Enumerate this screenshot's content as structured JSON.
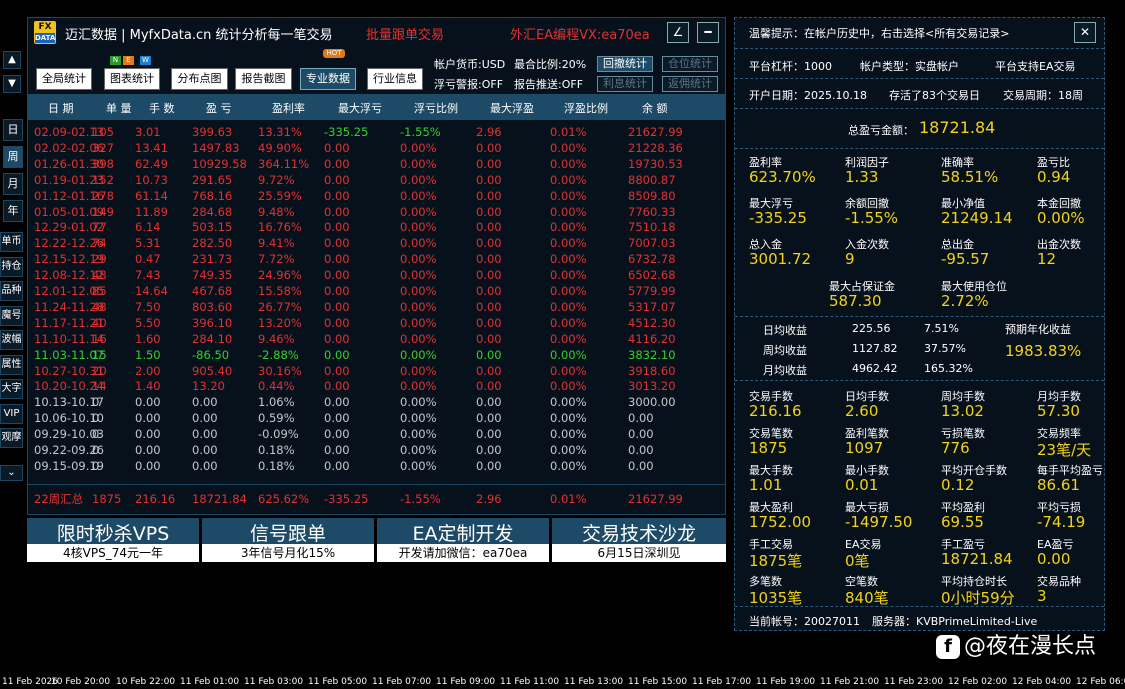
{
  "header": {
    "logo_top": "FX",
    "logo_bottom": "DATA",
    "title": "迈汇数据 | MyfxData.cn  统计分析每一笔交易",
    "batch": "批量跟单交易",
    "vx": "外汇EA编程VX:ea70ea",
    "pen": "∠",
    "minus": "━"
  },
  "nav": [
    {
      "label": "全局统计",
      "sel": false
    },
    {
      "label": "图表统计",
      "sel": false
    },
    {
      "label": "分布点图",
      "sel": false
    },
    {
      "label": "报告截图",
      "sel": false
    },
    {
      "label": "专业数据",
      "sel": true
    },
    {
      "label": "行业信息",
      "sel": false
    }
  ],
  "badges": {
    "n": "N",
    "e": "E",
    "w": "W",
    "hot": "HOT"
  },
  "info": {
    "currency": "帐户货币:USD",
    "ratio": "最合比例:20%",
    "float_alert": "浮亏警报:OFF",
    "report_push": "报告推送:OFF"
  },
  "small_buttons": [
    {
      "label": "回撤统计",
      "on": true
    },
    {
      "label": "仓位统计",
      "on": false
    },
    {
      "label": "利息统计",
      "on": false
    },
    {
      "label": "返佣统计",
      "on": false
    }
  ],
  "columns": [
    "日 期",
    "单 量",
    "手 数",
    "盈 亏",
    "盈利率",
    "最大浮亏",
    "浮亏比例",
    "最大浮盈",
    "浮盈比例",
    "余 额"
  ],
  "rows": [
    {
      "c": [
        "02.09-02.13",
        "105",
        "3.01",
        "399.63",
        "13.31%",
        "-335.25",
        "-1.55%",
        "2.96",
        "0.01%",
        "21627.99"
      ],
      "color": "#e23131",
      "special": true
    },
    {
      "c": [
        "02.02-02.06",
        "327",
        "13.41",
        "1497.83",
        "49.90%",
        "0.00",
        "0.00%",
        "0.00",
        "0.00%",
        "21228.36"
      ],
      "color": "#e23131"
    },
    {
      "c": [
        "01.26-01.30",
        "398",
        "62.49",
        "10929.58",
        "364.11%",
        "0.00",
        "0.00%",
        "0.00",
        "0.00%",
        "19730.53"
      ],
      "color": "#e23131"
    },
    {
      "c": [
        "01.19-01.23",
        "152",
        "10.73",
        "291.65",
        "9.72%",
        "0.00",
        "0.00%",
        "0.00",
        "0.00%",
        "8800.87"
      ],
      "color": "#e23131"
    },
    {
      "c": [
        "01.12-01.16",
        "278",
        "61.14",
        "768.16",
        "25.59%",
        "0.00",
        "0.00%",
        "0.00",
        "0.00%",
        "8509.80"
      ],
      "color": "#e23131"
    },
    {
      "c": [
        "01.05-01.09",
        "149",
        "11.89",
        "284.68",
        "9.48%",
        "0.00",
        "0.00%",
        "0.00",
        "0.00%",
        "7760.33"
      ],
      "color": "#e23131"
    },
    {
      "c": [
        "12.29-01.02",
        "77",
        "6.14",
        "503.15",
        "16.76%",
        "0.00",
        "0.00%",
        "0.00",
        "0.00%",
        "7510.18"
      ],
      "color": "#e23131"
    },
    {
      "c": [
        "12.22-12.26",
        "74",
        "5.31",
        "282.50",
        "9.41%",
        "0.00",
        "0.00%",
        "0.00",
        "0.00%",
        "7007.03"
      ],
      "color": "#e23131"
    },
    {
      "c": [
        "12.15-12.19",
        "29",
        "0.47",
        "231.73",
        "7.72%",
        "0.00",
        "0.00%",
        "0.00",
        "0.00%",
        "6732.78"
      ],
      "color": "#e23131"
    },
    {
      "c": [
        "12.08-12.12",
        "48",
        "7.43",
        "749.35",
        "24.96%",
        "0.00",
        "0.00%",
        "0.00",
        "0.00%",
        "6502.68"
      ],
      "color": "#e23131"
    },
    {
      "c": [
        "12.01-12.05",
        "85",
        "14.64",
        "467.68",
        "15.58%",
        "0.00",
        "0.00%",
        "0.00",
        "0.00%",
        "5779.99"
      ],
      "color": "#e23131"
    },
    {
      "c": [
        "11.24-11.28",
        "48",
        "7.50",
        "803.60",
        "26.77%",
        "0.00",
        "0.00%",
        "0.00",
        "0.00%",
        "5317.07"
      ],
      "color": "#e23131"
    },
    {
      "c": [
        "11.17-11.21",
        "40",
        "5.50",
        "396.10",
        "13.20%",
        "0.00",
        "0.00%",
        "0.00",
        "0.00%",
        "4512.30"
      ],
      "color": "#e23131"
    },
    {
      "c": [
        "11.10-11.14",
        "16",
        "1.60",
        "284.10",
        "9.46%",
        "0.00",
        "0.00%",
        "0.00",
        "0.00%",
        "4116.20"
      ],
      "color": "#e23131"
    },
    {
      "c": [
        "11.03-11.07",
        "15",
        "1.50",
        "-86.50",
        "-2.88%",
        "0.00",
        "0.00%",
        "0.00",
        "0.00%",
        "3832.10"
      ],
      "color": "#33d12e"
    },
    {
      "c": [
        "10.27-10.31",
        "20",
        "2.00",
        "905.40",
        "30.16%",
        "0.00",
        "0.00%",
        "0.00",
        "0.00%",
        "3918.60"
      ],
      "color": "#e23131"
    },
    {
      "c": [
        "10.20-10.24",
        "14",
        "1.40",
        "13.20",
        "0.44%",
        "0.00",
        "0.00%",
        "0.00",
        "0.00%",
        "3013.20"
      ],
      "color": "#e23131"
    },
    {
      "c": [
        "10.13-10.17",
        "0",
        "0.00",
        "0.00",
        "1.06%",
        "0.00",
        "0.00%",
        "0.00",
        "0.00%",
        "3000.00"
      ],
      "color": "#c8c8c8"
    },
    {
      "c": [
        "10.06-10.10",
        "0",
        "0.00",
        "0.00",
        "0.59%",
        "0.00",
        "0.00%",
        "0.00",
        "0.00%",
        "0.00"
      ],
      "color": "#c8c8c8"
    },
    {
      "c": [
        "09.29-10.03",
        "0",
        "0.00",
        "0.00",
        "-0.09%",
        "0.00",
        "0.00%",
        "0.00",
        "0.00%",
        "0.00"
      ],
      "color": "#c8c8c8"
    },
    {
      "c": [
        "09.22-09.26",
        "0",
        "0.00",
        "0.00",
        "0.18%",
        "0.00",
        "0.00%",
        "0.00",
        "0.00%",
        "0.00"
      ],
      "color": "#c8c8c8"
    },
    {
      "c": [
        "09.15-09.19",
        "0",
        "0.00",
        "0.00",
        "0.18%",
        "0.00",
        "0.00%",
        "0.00",
        "0.00%",
        "0.00"
      ],
      "color": "#c8c8c8"
    }
  ],
  "summary": [
    "22周汇总",
    "1875",
    "216.16",
    "18721.84",
    "625.62%",
    "-335.25",
    "-1.55%",
    "2.96",
    "0.01%",
    "21627.99"
  ],
  "banners": [
    {
      "title": "限时秒杀VPS",
      "sub": "4核VPS_74元一年"
    },
    {
      "title": "信号跟单",
      "sub": "3年信号月化15%"
    },
    {
      "title": "EA定制开发",
      "sub": "开发请加微信：ea70ea"
    },
    {
      "title": "交易技术沙龙",
      "sub": "6月15日深圳见"
    }
  ],
  "sidebar": {
    "up": "▲",
    "down": "▼",
    "tabs": [
      "日",
      "周",
      "月",
      "年"
    ],
    "items": [
      "单币",
      "持仓",
      "品种",
      "魔号",
      "波幅",
      "属性",
      "大字",
      "VIP",
      "观摩"
    ],
    "more": "⌄"
  },
  "right": {
    "tip": "温馨提示：在帐户历史中，右击选择<所有交易记录>",
    "close": "✕",
    "leverage": "平台杠杆：1000",
    "acct_type": "帐户类型：实盘帐户",
    "ea_support": "平台支持EA交易",
    "open_date": "开户日期：2025.10.18",
    "alive": "存活了83个交易日",
    "period": "交易周期：18周",
    "total_label": "总盈亏金额：",
    "total_value": "18721.84",
    "stats1": [
      {
        "l": "盈利率",
        "v": "623.70%"
      },
      {
        "l": "利润因子",
        "v": "1.33"
      },
      {
        "l": "准确率",
        "v": "58.51%"
      },
      {
        "l": "盈亏比",
        "v": "0.94"
      },
      {
        "l": "最大浮亏",
        "v": "-335.25"
      },
      {
        "l": "余额回撤",
        "v": "-1.55%"
      },
      {
        "l": "最小净值",
        "v": "21249.14"
      },
      {
        "l": "本金回撤",
        "v": "0.00%"
      },
      {
        "l": "总入金",
        "v": "3001.72"
      },
      {
        "l": "入金次数",
        "v": "9"
      },
      {
        "l": "总出金",
        "v": "-95.57"
      },
      {
        "l": "出金次数",
        "v": "12"
      }
    ],
    "margin": [
      {
        "l": "最大占保证金",
        "v": "587.30"
      },
      {
        "l": "最大使用仓位",
        "v": "2.72%"
      }
    ],
    "income": [
      {
        "l": "日均收益",
        "a": "225.56",
        "p": "7.51%"
      },
      {
        "l": "周均收益",
        "a": "1127.82",
        "p": "37.57%"
      },
      {
        "l": "月均收益",
        "a": "4962.42",
        "p": "165.32%"
      }
    ],
    "annual_label": "预期年化收益",
    "annual_value": "1983.83%",
    "stats2": [
      {
        "l": "交易手数",
        "v": "216.16"
      },
      {
        "l": "日均手数",
        "v": "2.60"
      },
      {
        "l": "周均手数",
        "v": "13.02"
      },
      {
        "l": "月均手数",
        "v": "57.30"
      },
      {
        "l": "交易笔数",
        "v": "1875"
      },
      {
        "l": "盈利笔数",
        "v": "1097"
      },
      {
        "l": "亏损笔数",
        "v": "776"
      },
      {
        "l": "交易频率",
        "v": "23笔/天"
      },
      {
        "l": "最大手数",
        "v": "1.01"
      },
      {
        "l": "最小手数",
        "v": "0.01"
      },
      {
        "l": "平均开仓手数",
        "v": "0.12"
      },
      {
        "l": "每手平均盈亏",
        "v": "86.61"
      },
      {
        "l": "最大盈利",
        "v": "1752.00"
      },
      {
        "l": "最大亏损",
        "v": "-1497.50"
      },
      {
        "l": "平均盈利",
        "v": "69.55"
      },
      {
        "l": "平均亏损",
        "v": "-74.19"
      },
      {
        "l": "手工交易",
        "v": "1875笔"
      },
      {
        "l": "EA交易",
        "v": "0笔"
      },
      {
        "l": "手工盈亏",
        "v": "18721.84"
      },
      {
        "l": "EA盈亏",
        "v": "0.00"
      },
      {
        "l": "多笔数",
        "v": "1035笔"
      },
      {
        "l": "空笔数",
        "v": "840笔"
      },
      {
        "l": "平均持仓时长",
        "v": "0小时59分"
      },
      {
        "l": "交易品种",
        "v": "3"
      }
    ],
    "account": "当前帐号：20027011",
    "server": "服务器：KVBPrimeLimited-Live"
  },
  "timeline": [
    "11 Feb 2026",
    "10 Feb 20:00",
    "10 Feb 22:00",
    "11 Feb 01:00",
    "11 Feb 03:00",
    "11 Feb 05:00",
    "11 Feb 07:00",
    "11 Feb 09:00",
    "11 Feb 11:00",
    "11 Feb 13:00",
    "11 Feb 15:00",
    "11 Feb 17:00",
    "11 Feb 19:00",
    "11 Feb 21:00",
    "11 Feb 23:00",
    "12 Feb 02:00",
    "12 Feb 04:00",
    "12 Feb 06:00"
  ],
  "watermark": {
    "icon": "f",
    "text": "@夜在漫长点"
  },
  "colors": {
    "red": "#e23131",
    "green": "#33d12e",
    "yellow": "#f2d21b",
    "header_blue": "#1d4a66"
  }
}
